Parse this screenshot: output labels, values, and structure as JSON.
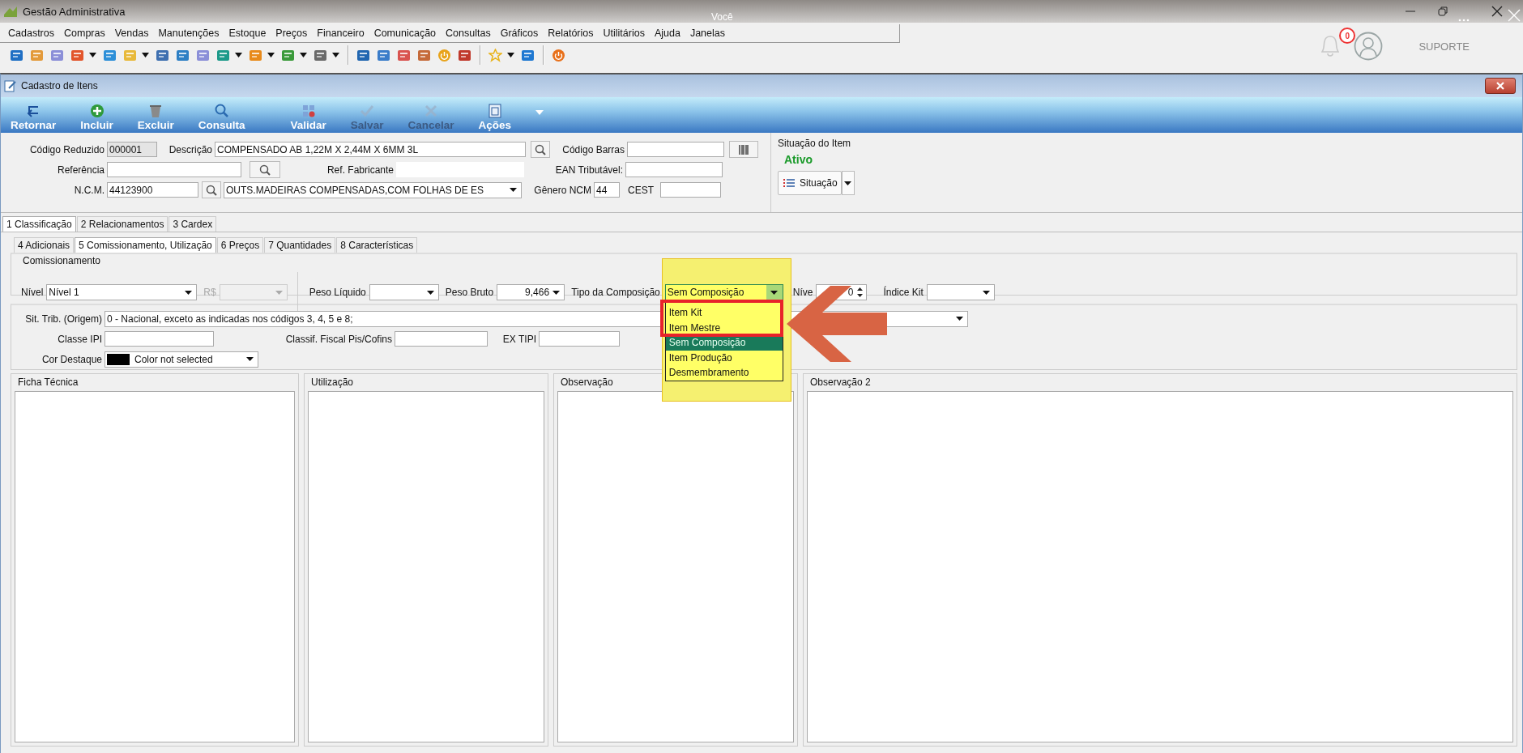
{
  "app": {
    "title": "Gestão Administrativa",
    "user_label": "Você",
    "notifications": "0",
    "support": "SUPORTE"
  },
  "menu": [
    "Cadastros",
    "Compras",
    "Vendas",
    "Manutenções",
    "Estoque",
    "Preços",
    "Financeiro",
    "Comunicação",
    "Consultas",
    "Gráficos",
    "Relatórios",
    "Utilitários",
    "Ajuda",
    "Janelas"
  ],
  "window": {
    "title": "Cadastro de Itens"
  },
  "actions": [
    {
      "label": "Retornar",
      "disabled": false
    },
    {
      "label": "Incluir",
      "disabled": false
    },
    {
      "label": "Excluir",
      "disabled": false
    },
    {
      "label": "Consulta",
      "disabled": false
    },
    {
      "label": "Validar",
      "disabled": false
    },
    {
      "label": "Salvar",
      "disabled": true
    },
    {
      "label": "Cancelar",
      "disabled": true
    },
    {
      "label": "Ações",
      "disabled": false
    }
  ],
  "item": {
    "code_label": "Código Reduzido",
    "code": "000001",
    "description_label": "Descrição",
    "description": "COMPENSADO AB 1,22M X 2,44M X 6MM 3L",
    "barcode_label": "Código Barras",
    "reference_label": "Referência",
    "maker_ref_label": "Ref. Fabricante",
    "ean_label": "EAN Tributável:",
    "ncm_label": "N.C.M.",
    "ncm": "44123900",
    "ncm_description": "OUTS.MADEIRAS COMPENSADAS,COM FOLHAS DE ES",
    "genre_label": "Gênero NCM",
    "genre": "44",
    "cest_label": "CEST"
  },
  "status": {
    "heading": "Situação do Item",
    "value": "Ativo",
    "button": "Situação"
  },
  "tabs": [
    {
      "label": "1 Classificação",
      "selected": true
    },
    {
      "label": "2 Relacionamentos",
      "selected": false
    },
    {
      "label": "3 Cardex",
      "selected": false
    }
  ],
  "subtabs": [
    {
      "label": "4 Adicionais",
      "selected": false
    },
    {
      "label": "5 Comissionamento, Utilização",
      "selected": true
    },
    {
      "label": "6 Preços",
      "selected": false
    },
    {
      "label": "7 Quantidades",
      "selected": false
    },
    {
      "label": "8 Características",
      "selected": false
    }
  ],
  "commission": {
    "heading": "Comissionamento",
    "level_label": "Nível",
    "level": "Nível 1",
    "currency_label": "R$",
    "currency_disabled": true,
    "net_weight_label": "Peso Líquido",
    "gross_weight_label": "Peso Bruto",
    "gross_weight": "9,466",
    "composition_label": "Tipo da Composição",
    "composition": "Sem Composição",
    "tier_label": "Níve",
    "tier": "0",
    "kit_index_label": "Índice Kit"
  },
  "composition_options": [
    {
      "label": "Item Kit",
      "selected": false
    },
    {
      "label": "Item Mestre",
      "selected": false
    },
    {
      "label": "Sem Composição",
      "selected": true
    },
    {
      "label": "Item Produção",
      "selected": false
    },
    {
      "label": "Desmembramento",
      "selected": false
    }
  ],
  "tax": {
    "origin_label": "Sit. Trib. (Origem)",
    "origin": "0 - Nacional, exceto as indicadas nos códigos 3, 4, 5 e 8;",
    "ipi_label": "Classe IPI",
    "pis_label": "Classif. Fiscal Pis/Cofins",
    "extipi_label": "EX TIPI",
    "color_label": "Cor Destaque",
    "color_text": "Color not selected"
  },
  "notes": [
    "Ficha Técnica",
    "Utilização",
    "Observação",
    "Observação 2"
  ]
}
